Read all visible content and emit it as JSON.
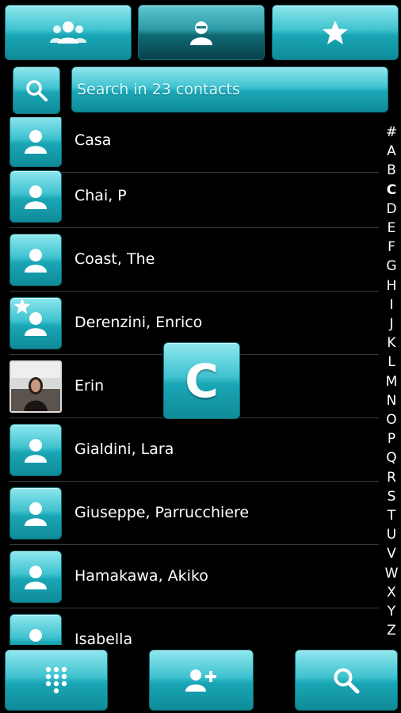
{
  "tabs": [
    {
      "id": "groups",
      "icon": "groups-icon"
    },
    {
      "id": "contacts",
      "icon": "contact-icon",
      "selected": true
    },
    {
      "id": "favorites",
      "icon": "star-icon"
    }
  ],
  "search": {
    "placeholder": "Search in 23 contacts",
    "icon": "search-icon"
  },
  "contacts": [
    {
      "name": "Casa"
    },
    {
      "name": "Chai, P"
    },
    {
      "name": "Coast, The"
    },
    {
      "name": "Derenzini, Enrico",
      "favorite": true
    },
    {
      "name": "Erin",
      "has_photo": true
    },
    {
      "name": "Gialdini, Lara"
    },
    {
      "name": "Giuseppe, Parrucchiere"
    },
    {
      "name": "Hamakawa, Akiko"
    },
    {
      "name": "Isabella"
    }
  ],
  "alphabet": [
    "#",
    "A",
    "B",
    "C",
    "D",
    "E",
    "F",
    "G",
    "H",
    "I",
    "J",
    "K",
    "L",
    "M",
    "N",
    "O",
    "P",
    "Q",
    "R",
    "S",
    "T",
    "U",
    "V",
    "W",
    "X",
    "Y",
    "Z"
  ],
  "active_letter": "C",
  "overlay_letter": "C",
  "bottom_bar": [
    {
      "id": "dialpad",
      "icon": "dialpad-icon"
    },
    {
      "id": "add-contact",
      "icon": "add-contact-icon"
    },
    {
      "id": "search",
      "icon": "search-icon"
    }
  ],
  "colors": {
    "accent": "#2bb7c5",
    "background": "#000000",
    "divider": "#3a3a3a"
  }
}
